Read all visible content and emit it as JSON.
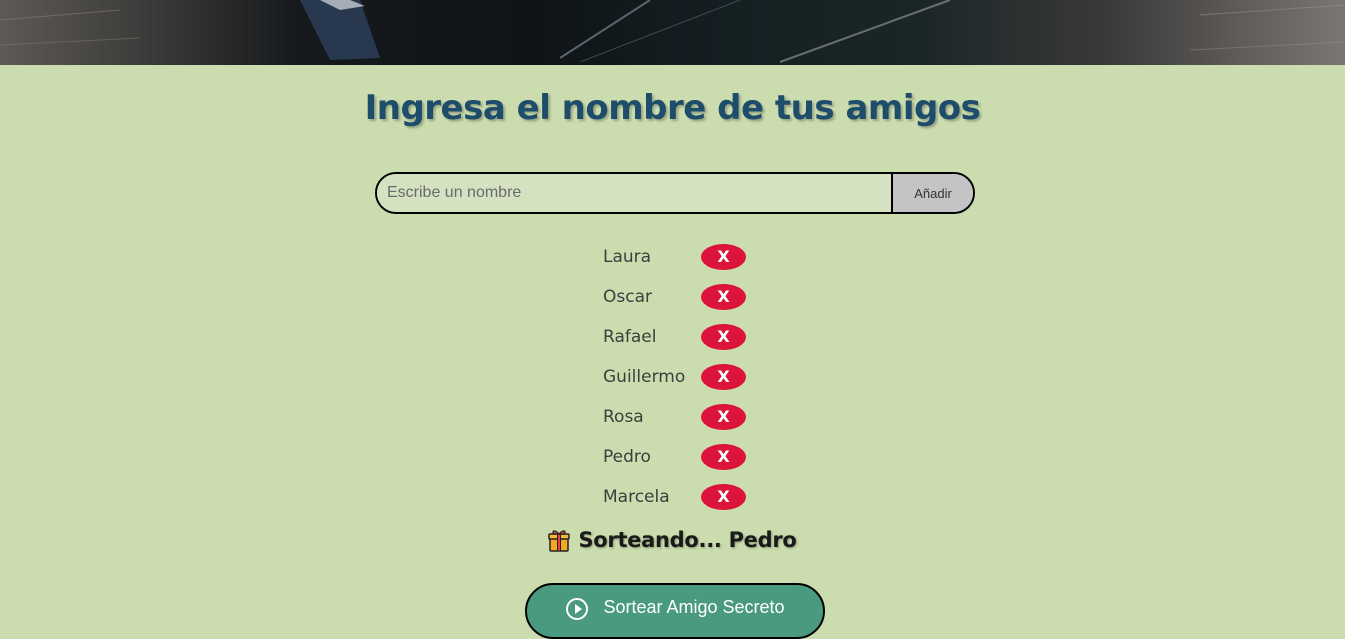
{
  "header": {
    "title": "Ingresa el nombre de tus amigos"
  },
  "form": {
    "input_placeholder": "Escribe un nombre",
    "input_value": "",
    "add_label": "Añadir"
  },
  "friends": [
    {
      "name": "Laura",
      "remove_label": "X"
    },
    {
      "name": "Oscar",
      "remove_label": "X"
    },
    {
      "name": "Rafael",
      "remove_label": "X"
    },
    {
      "name": "Guillermo",
      "remove_label": "X"
    },
    {
      "name": "Rosa",
      "remove_label": "X"
    },
    {
      "name": "Pedro",
      "remove_label": "X"
    },
    {
      "name": "Marcela",
      "remove_label": "X"
    }
  ],
  "result": {
    "text": "Sorteando... Pedro",
    "icon": "gift-icon"
  },
  "draw_button": {
    "label": "Sortear Amigo Secreto",
    "icon": "play-icon"
  },
  "colors": {
    "background": "#cbdcae",
    "title": "#1e4d6b",
    "remove_button": "#dc143c",
    "draw_button": "#4a9a82",
    "add_button": "#c4c4c6"
  }
}
